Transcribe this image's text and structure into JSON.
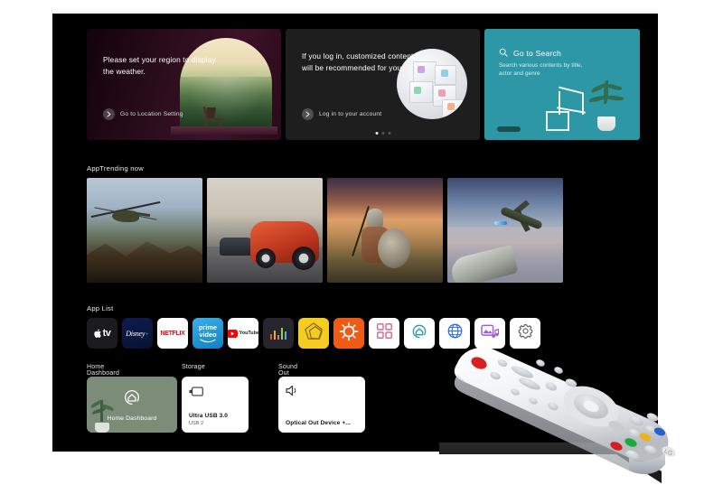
{
  "device": {
    "type": "LG webOS TV Home Screen",
    "remote_brand": "LG"
  },
  "hero": {
    "cards": [
      {
        "id": "weather",
        "headline": "Please set your region to display the weather.",
        "cta": "Go to Location Setting",
        "cta_icon": "chevron-right-icon",
        "bg_color": "#2b0d1d"
      },
      {
        "id": "login",
        "headline": "If you log in, customized contents will be recommended for you.",
        "cta": "Log in to your account",
        "cta_icon": "chevron-right-icon",
        "bg_color": "#1e1e1e"
      },
      {
        "id": "search",
        "headline": "Go to Search",
        "subtext": "Search various contents by title, actor and genre",
        "icon": "search-icon",
        "bg_color": "#2d97a6"
      }
    ],
    "carousel": {
      "total": 3,
      "active_index": 0
    }
  },
  "sections": {
    "trending_label": "AppTrending now",
    "app_list_label": "App List"
  },
  "trending": [
    {
      "id": "helicopter",
      "alt": "Helicopter over mountains"
    },
    {
      "id": "race-car",
      "alt": "Red sports car chased by police car"
    },
    {
      "id": "warrior",
      "alt": "Armored warrior with shield at sunset"
    },
    {
      "id": "fighter-jet",
      "alt": "Fighter jets above the clouds"
    }
  ],
  "apps": [
    {
      "name": "Apple TV",
      "icon": "apple-tv-icon",
      "bg": "#1b1b1d",
      "fg": "#ffffff"
    },
    {
      "name": "Disney+",
      "icon": "disney-plus-icon",
      "bg": "#0b1b48",
      "fg": "#ffffff"
    },
    {
      "name": "Netflix",
      "icon": "netflix-icon",
      "bg": "#ffffff",
      "fg": "#e50914"
    },
    {
      "name": "prime video",
      "icon": "prime-video-icon",
      "bg": "#1a98d8",
      "fg": "#ffffff"
    },
    {
      "name": "YouTube",
      "icon": "youtube-icon",
      "bg": "#ffffff",
      "fg": "#ff0000"
    },
    {
      "name": "Music Charts",
      "icon": "equalizer-bars-icon",
      "bg": "#26262c",
      "fg": "#ffffff"
    },
    {
      "name": "LG Channels",
      "icon": "pentagon-shapes-icon",
      "bg": "#f4cc22",
      "fg": "#8a6a00"
    },
    {
      "name": "Gallery",
      "icon": "sun-burst-icon",
      "bg": "#f05a14",
      "fg": "#ffffff"
    },
    {
      "name": "App List",
      "icon": "grid-squares-icon",
      "bg": "#ffffff",
      "fg": "#d46a8f"
    },
    {
      "name": "Home Dashboard",
      "icon": "home-dashboard-icon",
      "bg": "#ffffff",
      "fg": "#1f9e9e"
    },
    {
      "name": "Web Browser",
      "icon": "globe-icon",
      "bg": "#ffffff",
      "fg": "#2e6fd0"
    },
    {
      "name": "Media Player",
      "icon": "media-player-icon",
      "bg": "#ffffff",
      "fg": "#9b5de5"
    },
    {
      "name": "Settings",
      "icon": "gear-icon",
      "bg": "#ffffff",
      "fg": "#5a5a5a"
    }
  ],
  "tiles": [
    {
      "id": "home-dashboard",
      "title": "Home Dashboard",
      "card_label": "Home Dashboard",
      "icon": "home-dashboard-icon",
      "bg": "#7d8c79"
    },
    {
      "id": "storage",
      "title": "Storage",
      "name": "Ultra USB 3.0",
      "sub": "USB 2",
      "icon": "usb-drive-icon",
      "bg": "#ffffff"
    },
    {
      "id": "sound-out",
      "title": "Sound Out",
      "name": "Optical Out Device +...",
      "icon": "speaker-icon",
      "bg": "#ffffff"
    }
  ]
}
